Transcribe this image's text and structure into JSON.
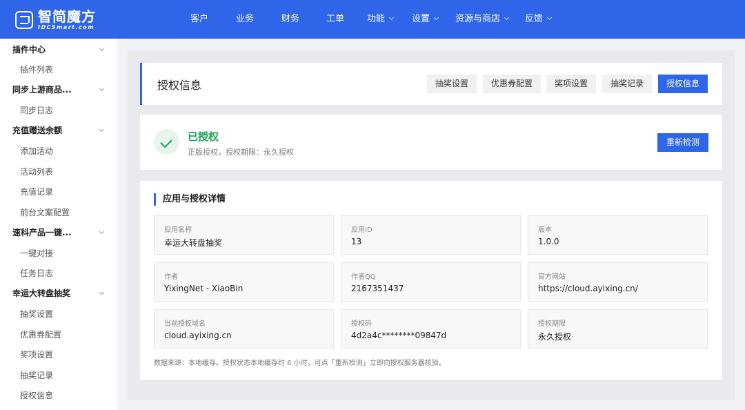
{
  "logo": {
    "cn": "智简魔方",
    "en": "IDCSmart.com"
  },
  "nav": [
    {
      "label": "客户",
      "dropdown": false
    },
    {
      "label": "业务",
      "dropdown": false
    },
    {
      "label": "财务",
      "dropdown": false
    },
    {
      "label": "工单",
      "dropdown": false
    },
    {
      "label": "功能",
      "dropdown": true
    },
    {
      "label": "设置",
      "dropdown": true
    },
    {
      "label": "资源与商店",
      "dropdown": true
    },
    {
      "label": "反馈",
      "dropdown": true
    }
  ],
  "sidebar": {
    "items": [
      {
        "label": "插件中心",
        "type": "group"
      },
      {
        "label": "插件列表",
        "type": "sub"
      },
      {
        "label": "同步上游商品...",
        "type": "group"
      },
      {
        "label": "同步日志",
        "type": "sub"
      },
      {
        "label": "充值赠送余额",
        "type": "group"
      },
      {
        "label": "添加活动",
        "type": "sub"
      },
      {
        "label": "活动列表",
        "type": "sub"
      },
      {
        "label": "充值记录",
        "type": "sub"
      },
      {
        "label": "前台文案配置",
        "type": "sub"
      },
      {
        "label": "速科产品一键...",
        "type": "group"
      },
      {
        "label": "一键对接",
        "type": "sub"
      },
      {
        "label": "任务日志",
        "type": "sub"
      },
      {
        "label": "幸运大转盘抽奖",
        "type": "group"
      },
      {
        "label": "抽奖设置",
        "type": "sub"
      },
      {
        "label": "优惠券配置",
        "type": "sub"
      },
      {
        "label": "奖项设置",
        "type": "sub"
      },
      {
        "label": "抽奖记录",
        "type": "sub"
      },
      {
        "label": "授权信息",
        "type": "sub"
      }
    ]
  },
  "header": {
    "title": "授权信息",
    "tabs": [
      {
        "label": "抽奖设置",
        "active": false
      },
      {
        "label": "优惠券配置",
        "active": false
      },
      {
        "label": "奖项设置",
        "active": false
      },
      {
        "label": "抽奖记录",
        "active": false
      },
      {
        "label": "授权信息",
        "active": true
      }
    ]
  },
  "status": {
    "title": "已授权",
    "description": "正版授权，授权期限：永久授权",
    "recheck_label": "重新检测"
  },
  "details": {
    "section_title": "应用与授权详情",
    "fields": [
      {
        "label": "应用名称",
        "value": "幸运大转盘抽奖"
      },
      {
        "label": "应用ID",
        "value": "13"
      },
      {
        "label": "版本",
        "value": "1.0.0"
      },
      {
        "label": "作者",
        "value": "YixingNet - XiaoBin"
      },
      {
        "label": "作者QQ",
        "value": "2167351437"
      },
      {
        "label": "官方网站",
        "value": "https://cloud.ayixing.cn/"
      },
      {
        "label": "当前授权域名",
        "value": "cloud.ayixing.cn"
      },
      {
        "label": "授权码",
        "value": "4d2a4c********09847d"
      },
      {
        "label": "授权期限",
        "value": "永久授权"
      }
    ],
    "footnote": "数据来源：本地缓存。授权状态本地缓存约 6 小时，可点「重新检测」立即向授权服务器核验。"
  },
  "colors": {
    "primary": "#2f65e8",
    "success": "#18a058"
  }
}
